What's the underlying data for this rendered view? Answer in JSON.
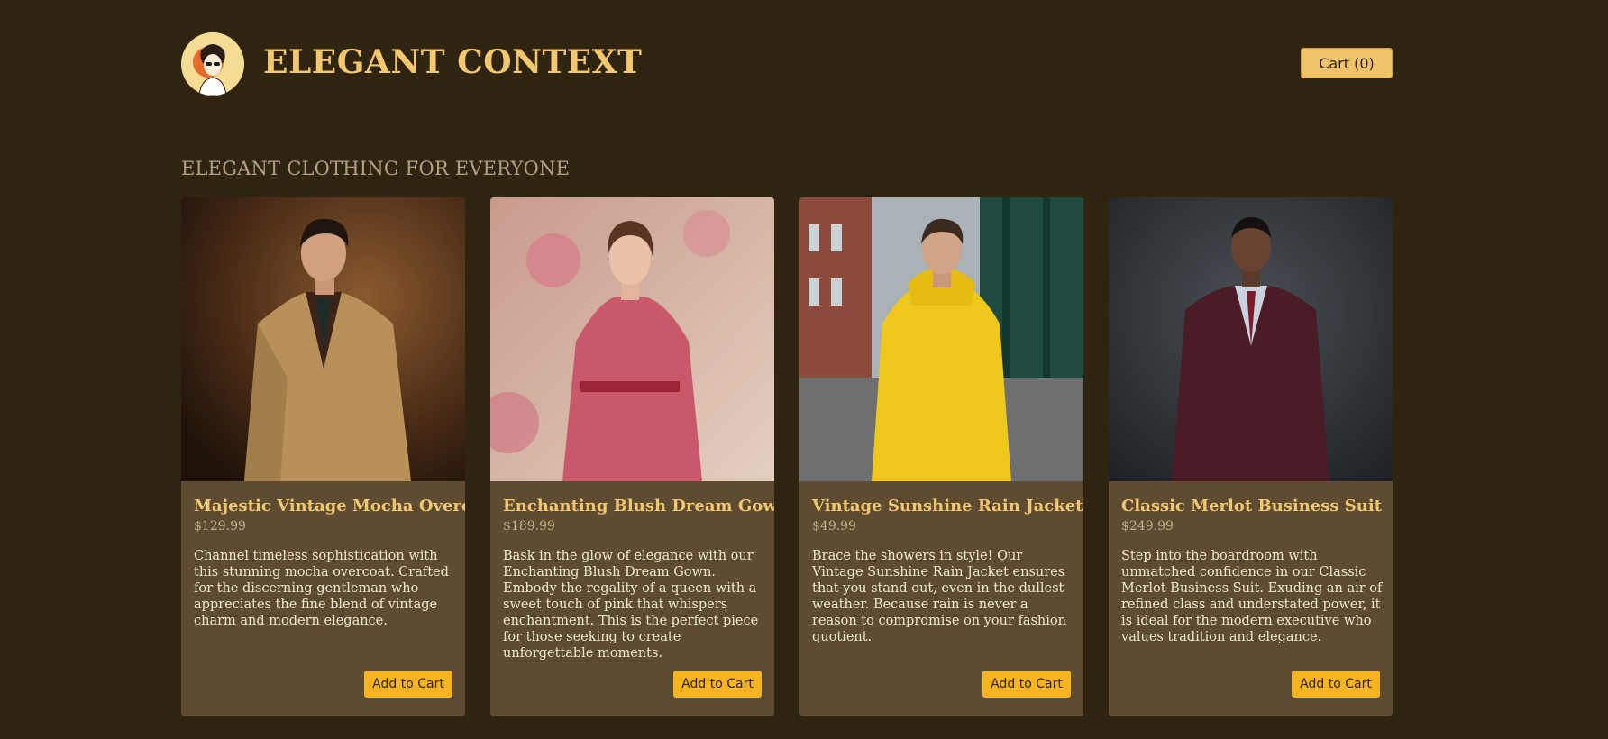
{
  "header": {
    "brand": "ELEGANT CONTEXT",
    "logo_icon": "woman-portrait-logo-icon",
    "cart_label": "Cart (0)"
  },
  "section_title": "ELEGANT CLOTHING FOR EVERYONE",
  "colors": {
    "background": "#2f2410",
    "card": "#5d4c32",
    "accent": "#f2c76e",
    "button": "#f6b420"
  },
  "products": [
    {
      "name": "Majestic Vintage Mocha Overcoat",
      "price": "$129.99",
      "description": "Channel timeless sophistication with this stunning mocha overcoat. Crafted for the discerning gentleman who appreciates the fine blend of vintage charm and modern elegance.",
      "button": "Add to Cart",
      "image": "man-in-mocha-overcoat-photo"
    },
    {
      "name": "Enchanting Blush Dream Gown",
      "price": "$189.99",
      "description": "Bask in the glow of elegance with our Enchanting Blush Dream Gown. Embody the regality of a queen with a sweet touch of pink that whispers enchantment. This is the perfect piece for those seeking to create unforgettable moments.",
      "button": "Add to Cart",
      "image": "woman-in-pink-gown-photo"
    },
    {
      "name": "Vintage Sunshine Rain Jacket",
      "price": "$49.99",
      "description": "Brace the showers in style! Our Vintage Sunshine Rain Jacket ensures that you stand out, even in the dullest weather. Because rain is never a reason to compromise on your fashion quotient.",
      "button": "Add to Cart",
      "image": "man-in-yellow-raincoat-photo"
    },
    {
      "name": "Classic Merlot Business Suit",
      "price": "$249.99",
      "description": "Step into the boardroom with unmatched confidence in our Classic Merlot Business Suit. Exuding an air of refined class and understated power, it is ideal for the modern executive who values tradition and elegance.",
      "button": "Add to Cart",
      "image": "man-in-merlot-suit-photo"
    }
  ]
}
